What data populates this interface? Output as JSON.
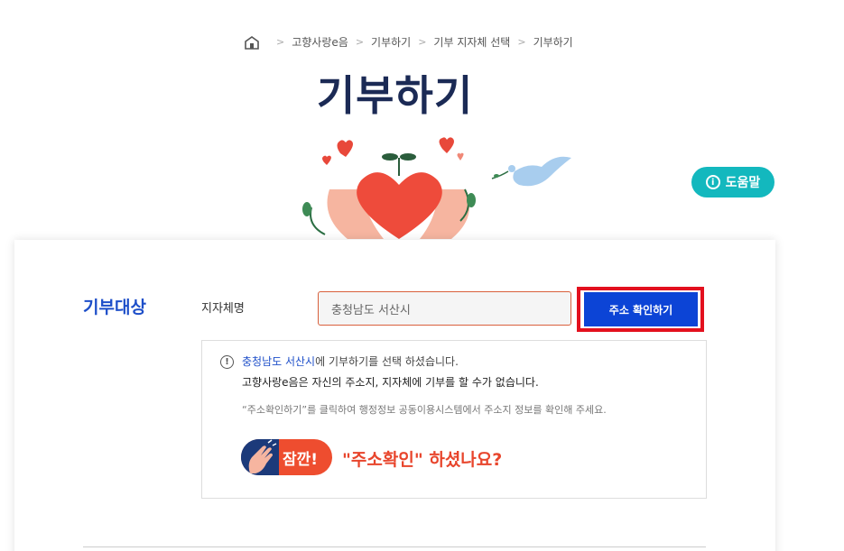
{
  "breadcrumb": {
    "items": [
      "고향사랑e음",
      "기부하기",
      "기부 지자체 선택",
      "기부하기"
    ]
  },
  "page_title": "기부하기",
  "help_button": {
    "label": "도움말",
    "icon": "info-icon"
  },
  "form": {
    "section_title": "기부대상",
    "field_label": "지자체명",
    "region_value": "충청남도 서산시",
    "confirm_label": "주소 확인하기"
  },
  "notice": {
    "line1_highlight": "충청남도 서산시",
    "line1_rest": "에 기부하기를 선택 하셨습니다.",
    "line2": "고향사랑e음은 자신의 주소지, 지자체에 기부를 할 수가 없습니다.",
    "line3": "“주소확인하기”를 클릭하여 행정정보 공동이용시스템에서 주소지 정보를 확인해 주세요.",
    "badge_text": "잠깐!",
    "question": "\"주소확인\" 하셨나요?"
  },
  "colors": {
    "title": "#1b2a55",
    "accent_blue": "#1e4fc9",
    "button_blue": "#0c44d6",
    "help_teal": "#13b8be",
    "highlight_red": "#e3101e",
    "warn_orange": "#ee4d2f"
  }
}
